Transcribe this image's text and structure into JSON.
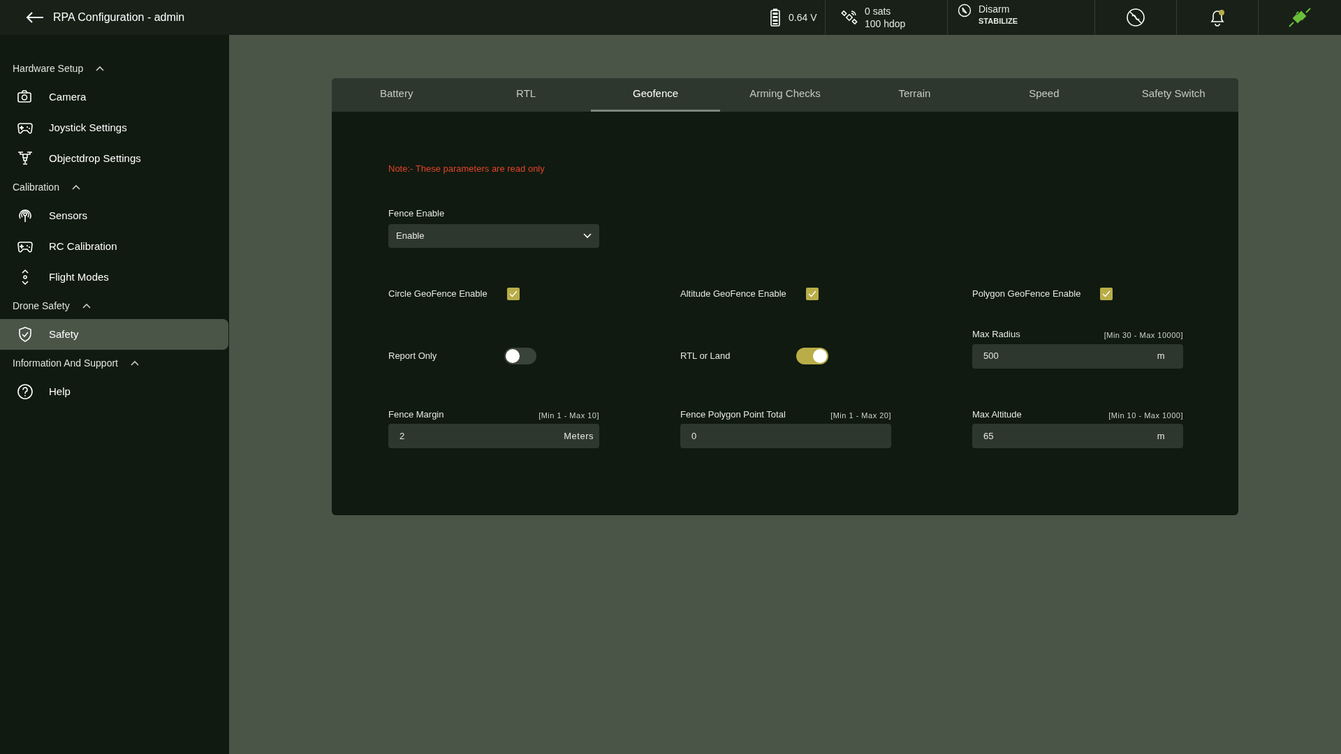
{
  "window": {
    "title": "RPA Configuration - admin"
  },
  "status": {
    "battery": "0.64 V",
    "gps_sats": "0 sats",
    "gps_hdop": "100 hdop",
    "arm_state": "Disarm",
    "flight_mode": "STABILIZE",
    "notification_unread": true
  },
  "sidebar": {
    "sections": [
      {
        "title": "Hardware Setup",
        "expanded": true,
        "items": [
          {
            "label": "Camera",
            "selected": false
          },
          {
            "label": "Joystick Settings",
            "selected": false
          },
          {
            "label": "Objectdrop Settings",
            "selected": false
          }
        ]
      },
      {
        "title": "Calibration",
        "expanded": true,
        "items": [
          {
            "label": "Sensors",
            "selected": false
          },
          {
            "label": "RC Calibration",
            "selected": false
          },
          {
            "label": "Flight Modes",
            "selected": false
          }
        ]
      },
      {
        "title": "Drone Safety",
        "expanded": true,
        "items": [
          {
            "label": "Safety",
            "selected": true
          }
        ]
      },
      {
        "title": "Information And Support",
        "expanded": true,
        "items": [
          {
            "label": "Help",
            "selected": false
          }
        ]
      }
    ]
  },
  "tabs": [
    {
      "label": "Battery",
      "selected": false
    },
    {
      "label": "RTL",
      "selected": false
    },
    {
      "label": "Geofence",
      "selected": true
    },
    {
      "label": "Arming Checks",
      "selected": false
    },
    {
      "label": "Terrain",
      "selected": false
    },
    {
      "label": "Speed",
      "selected": false
    },
    {
      "label": "Safety Switch",
      "selected": false
    }
  ],
  "note": "Note:- These parameters are read only",
  "fence_enable": {
    "label": "Fence Enable",
    "value": "Enable"
  },
  "setting_rows": [
    [
      {
        "kind": "checkbox",
        "label": "Circle GeoFence Enable",
        "checked": true
      },
      {
        "kind": "checkbox",
        "label": "Altitude GeoFence Enable",
        "checked": true
      },
      {
        "kind": "checkbox",
        "label": "Polygon GeoFence Enable",
        "checked": true
      }
    ],
    [
      {
        "kind": "toggle",
        "label": "Report Only",
        "on": false
      },
      {
        "kind": "toggle",
        "label": "RTL or Land",
        "on": true
      },
      {
        "kind": "number",
        "label": "Max Radius",
        "range": "[Min 30 - Max 10000]",
        "value": "500",
        "unit": "m"
      }
    ],
    [
      {
        "kind": "number",
        "label": "Fence Margin",
        "range": "[Min 1 - Max 10]",
        "value": "2",
        "unit": "Meters"
      },
      {
        "kind": "number",
        "label": "Fence Polygon Point Total",
        "range": "[Min 1 - Max 20]",
        "value": "0"
      },
      {
        "kind": "number",
        "label": "Max Altitude",
        "range": "[Min 10 - Max 1000]",
        "value": "65",
        "unit": "m"
      }
    ]
  ]
}
